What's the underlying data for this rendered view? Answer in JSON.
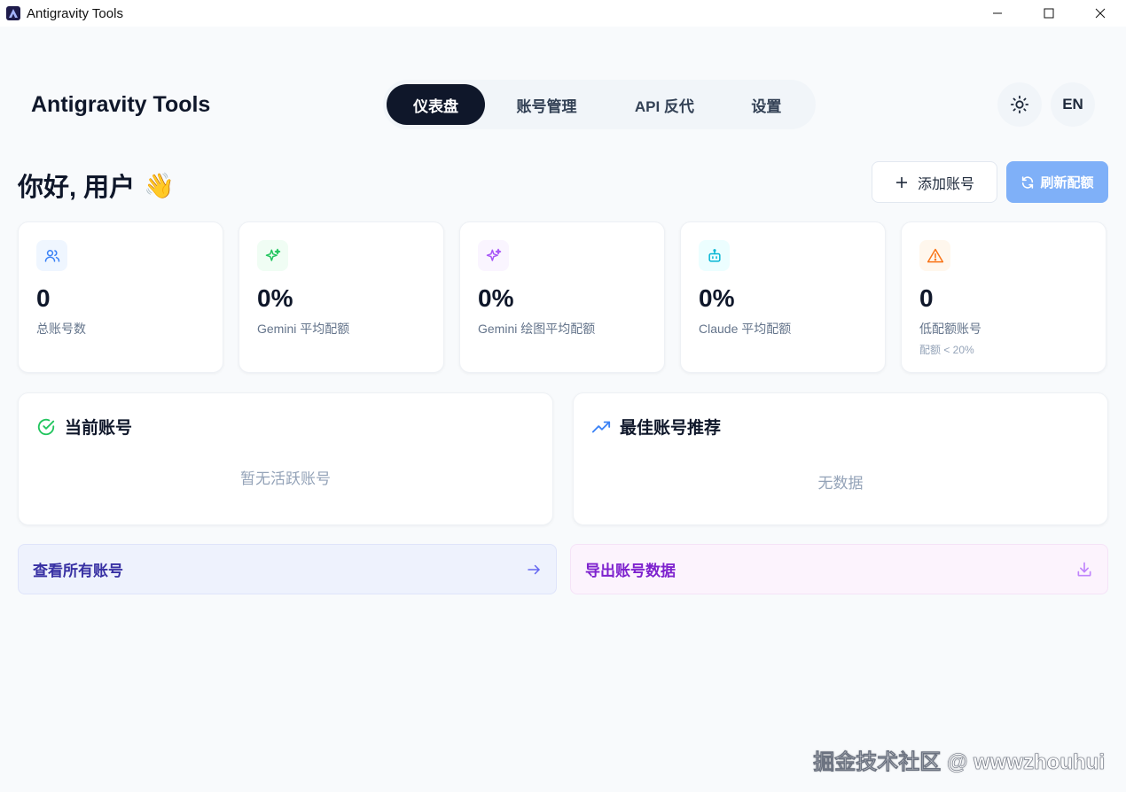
{
  "window": {
    "title": "Antigravity Tools",
    "controls": [
      "minimize-icon",
      "maximize-icon",
      "close-icon"
    ]
  },
  "header": {
    "brand": "Antigravity Tools",
    "nav": [
      {
        "label": "仪表盘",
        "active": true
      },
      {
        "label": "账号管理",
        "active": false
      },
      {
        "label": "API 反代",
        "active": false
      },
      {
        "label": "设置",
        "active": false
      }
    ],
    "theme_icon": "sun-icon",
    "language": "EN"
  },
  "greeting": {
    "text": "你好, 用户",
    "emoji": "👋"
  },
  "actions": {
    "add_account": "添加账号",
    "refresh_quota": "刷新配额"
  },
  "stats": [
    {
      "icon": "users-icon",
      "value": "0",
      "label": "总账号数",
      "color": "#3b82f6",
      "bg": "#eff6ff"
    },
    {
      "icon": "sparkles-icon",
      "value": "0%",
      "label": "Gemini 平均配额",
      "color": "#22c55e",
      "bg": "#f0fdf4"
    },
    {
      "icon": "sparkles-icon",
      "value": "0%",
      "label": "Gemini 绘图平均配额",
      "color": "#a855f7",
      "bg": "#faf5ff"
    },
    {
      "icon": "bot-icon",
      "value": "0%",
      "label": "Claude 平均配额",
      "color": "#06b6d4",
      "bg": "#ecfeff"
    },
    {
      "icon": "warning-icon",
      "value": "0",
      "label": "低配额账号",
      "sub": "配额 < 20%",
      "color": "#f97316",
      "bg": "#fff7ed"
    }
  ],
  "panels": {
    "current_account": {
      "title": "当前账号",
      "empty": "暂无活跃账号"
    },
    "best_account": {
      "title": "最佳账号推荐",
      "empty": "无数据"
    }
  },
  "links": {
    "view_all": "查看所有账号",
    "export": "导出账号数据"
  },
  "watermark": "掘金技术社区 @ wwwzhouhui",
  "colors": {
    "primary_dark": "#0f172a",
    "refresh_button": "#7fb0f8",
    "page_bg": "#f8fafc"
  }
}
